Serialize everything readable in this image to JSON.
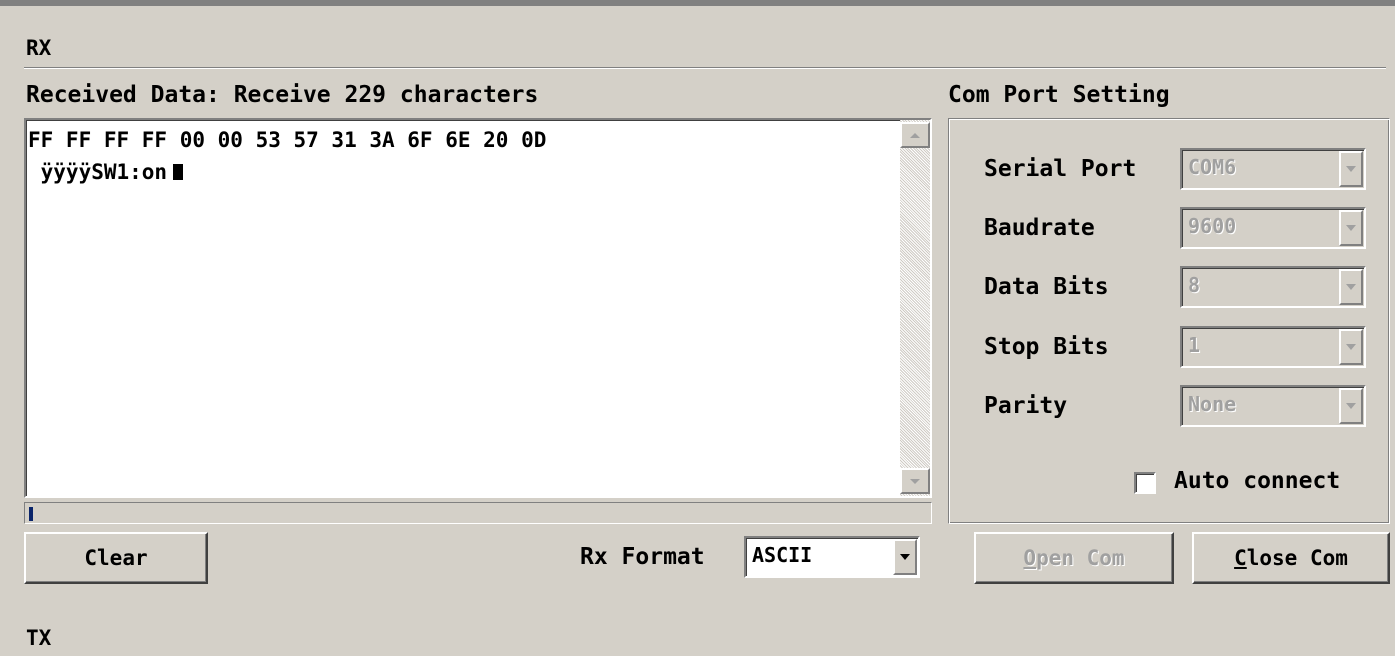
{
  "rx_section": {
    "title": "RX",
    "received_label": "Received Data: Receive 229 characters",
    "hex_line": "FF FF FF FF 00 00 53 57 31 3A 6F 6E 20 0D",
    "ascii_line": " ÿÿÿÿSW1:on",
    "progress_fraction": 0.004,
    "clear_button": "Clear",
    "rx_format_label": "Rx Format",
    "rx_format_value": "ASCII"
  },
  "com_port": {
    "title": "Com Port Setting",
    "settings": [
      {
        "label": "Serial Port",
        "value": "COM6"
      },
      {
        "label": "Baudrate",
        "value": "9600"
      },
      {
        "label": "Data Bits",
        "value": "8"
      },
      {
        "label": "Stop Bits",
        "value": "1"
      },
      {
        "label": "Parity",
        "value": "None"
      }
    ],
    "auto_connect_label": "Auto connect",
    "auto_connect_checked": false,
    "open_button": {
      "accel": "O",
      "rest": "pen Com",
      "enabled": false
    },
    "close_button": {
      "accel": "C",
      "rest": "lose Com",
      "enabled": true
    }
  },
  "tx_section": {
    "title": "TX"
  },
  "colors": {
    "window_bg": "#d4d0c8",
    "text_area_bg": "#ffffff",
    "progress_fill": "#0a246a",
    "disabled_text": "#a0a0a0"
  }
}
